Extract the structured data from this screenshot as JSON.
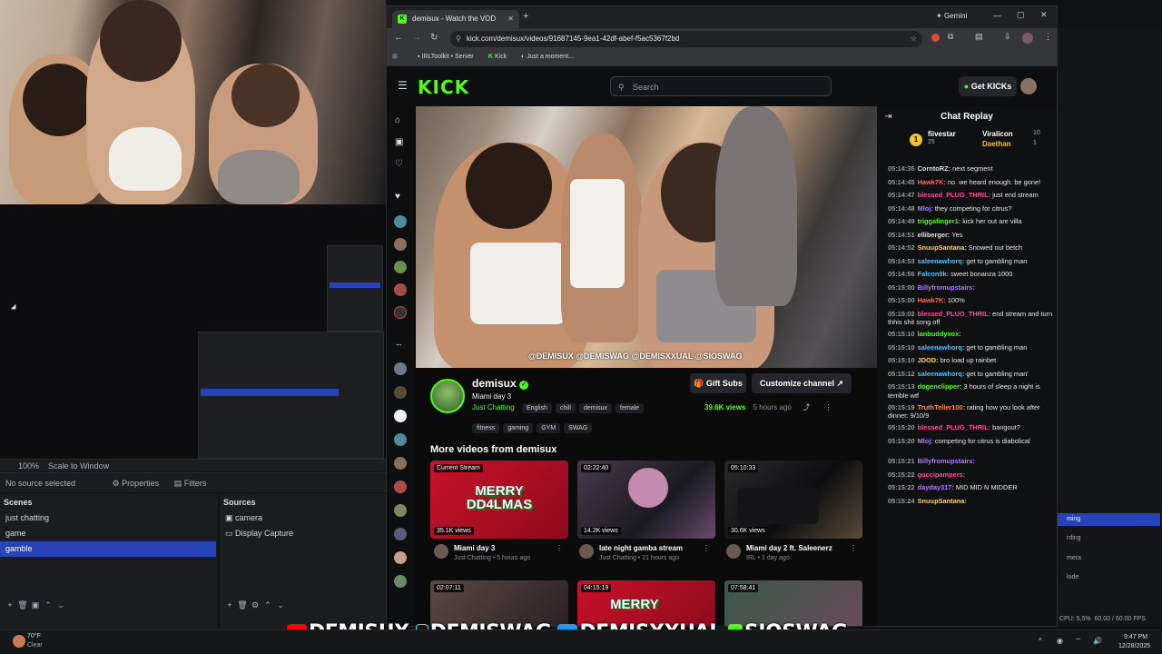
{
  "obs": {
    "no_source_label": "No source selected",
    "properties_label": "Properties",
    "filters_label": "Filters",
    "scenes_title": "Scenes",
    "sources_title": "Sources",
    "scenes": [
      "just chatting",
      "game",
      "gamble"
    ],
    "selected_scene": "gamble",
    "sources": [
      "camera",
      "Display Capture"
    ],
    "zoom_label": "100%",
    "scale_label": "Scale to Window",
    "right_items": [
      "ming",
      "rding",
      "mera",
      "lode"
    ],
    "status": "CPU: 5.5%",
    "fps": "60.00 / 60.00 FPS"
  },
  "browser": {
    "tab_title": "demisux - Watch the VOD",
    "new_tab": "+",
    "gemini_label": "Gemini",
    "url": "kick.com/demisux/videos/91687145-9ea1-42df-abef-f5ac5367f2bd",
    "bookmarks": [
      "IRLToolkit • Server",
      "Kick",
      "Just a moment..."
    ]
  },
  "kick": {
    "logo": "KICK",
    "search_placeholder": "Search",
    "get_kicks": "Get KICKs",
    "video_caption": "@DEMISUX @DEMISWAG @DEMISXXUAL @SIOSWAG",
    "channel_name": "demisux",
    "stream_title": "Miami day 3",
    "category": "Just Chatting",
    "tags_row1": [
      "English",
      "chill",
      "demisux",
      "female"
    ],
    "tags_row2": [
      "fitness",
      "gaming",
      "GYM",
      "SWAG"
    ],
    "gift_subs": "Gift Subs",
    "customize": "Customize channel",
    "views": "39.6K views",
    "ago": "5 hours ago",
    "more_videos": "More videos from demisux",
    "videos": [
      {
        "badge": "Current Stream",
        "views": "35.1K views",
        "title": "Miami day 3",
        "sub": "Just Chatting • 5 hours ago",
        "thumb_text": "MERRY DD4LMAS"
      },
      {
        "badge": "02:22:40",
        "views": "14.2K views",
        "title": "late night gamba stream",
        "sub": "Just Chatting • 21 hours ago",
        "thumb_text": ""
      },
      {
        "badge": "05:10:33",
        "views": "30.6K views",
        "title": "Miami day 2 ft. Saleenerz",
        "sub": "IRL • 1 day ago",
        "thumb_text": ""
      }
    ],
    "videos_row2": [
      {
        "badge": "02:07:11"
      },
      {
        "badge": "04:15:19",
        "thumb_text": "MERRY"
      },
      {
        "badge": "07:58:41"
      }
    ]
  },
  "chat": {
    "title": "Chat Replay",
    "leaders": [
      {
        "rank": "1",
        "name": "fiivestar",
        "count": "25"
      },
      {
        "rank": "",
        "name": "Viralicon",
        "count": "10"
      },
      {
        "rank": "",
        "name": "Daethan",
        "count": "1"
      }
    ],
    "messages": [
      {
        "t": "05:14:35",
        "u": "CorntoRZ:",
        "c": "#e0e0e0",
        "m": "next segment"
      },
      {
        "t": "05:14:45",
        "u": "Hawk7K:",
        "c": "#ff6b6b",
        "m": "no. we heard enough. be gone!"
      },
      {
        "t": "05:14:47",
        "u": "blessed_PLUG_THRIL:",
        "c": "#ff4fa0",
        "m": "just end stream"
      },
      {
        "t": "05:14:48",
        "u": "Mloj:",
        "c": "#b07bff",
        "m": "they competing for citrus?"
      },
      {
        "t": "05:14:49",
        "u": "triggafinger1:",
        "c": "#53fc18",
        "m": "kick her out are villa"
      },
      {
        "t": "05:14:51",
        "u": "elliberger:",
        "c": "#e0e0e0",
        "m": "Yes"
      },
      {
        "t": "05:14:52",
        "u": "SnuupSantana:",
        "c": "#ffd166",
        "m": "Snowed out betch"
      },
      {
        "t": "05:14:53",
        "u": "saleenawhorq:",
        "c": "#4fc3ff",
        "m": "get to gambling man"
      },
      {
        "t": "05:14:56",
        "u": "Falcon9k:",
        "c": "#4fc3ff",
        "m": "sweet bonanza 1000"
      },
      {
        "t": "05:15:00",
        "u": "Billyfromupstairs:",
        "c": "#b07bff",
        "m": ""
      },
      {
        "t": "05:15:00",
        "u": "Hawk7K:",
        "c": "#ff6b6b",
        "m": "100%"
      },
      {
        "t": "05:15:02",
        "u": "blessed_PLUG_THRIL:",
        "c": "#ff4fa0",
        "m": "end stream and turn thhis shit song off"
      },
      {
        "t": "05:15:10",
        "u": "lanbuddyxox:",
        "c": "#53fc18",
        "m": ""
      },
      {
        "t": "05:15:10",
        "u": "saleenawhorq:",
        "c": "#4fc3ff",
        "m": "get to gambling man"
      },
      {
        "t": "05:15:10",
        "u": "JDOD:",
        "c": "#ffd166",
        "m": "bro load up rainbet"
      },
      {
        "t": "05:15:12",
        "u": "saleenawhorq:",
        "c": "#4fc3ff",
        "m": "get to gambling man'"
      },
      {
        "t": "05:15:13",
        "u": "dogenclipper:",
        "c": "#53fc18",
        "m": "3 hours of sleep a night is terrible wtf"
      },
      {
        "t": "05:15:19",
        "u": "TruthTeller100:",
        "c": "#ff8c42",
        "m": "rating how you look after dinner: 9/10/9"
      },
      {
        "t": "05:15:20",
        "u": "blessed_PLUG_THRIL:",
        "c": "#ff4fa0",
        "m": "bangout?"
      },
      {
        "t": "05:15:20",
        "u": "Mloj:",
        "c": "#b07bff",
        "m": "competing for citrus is diabolical"
      },
      {
        "t": "05:15:21",
        "u": "Billyfromupstairs:",
        "c": "#b07bff",
        "m": ""
      },
      {
        "t": "05:15:22",
        "u": "guccipampers:",
        "c": "#ff4fa0",
        "m": ""
      },
      {
        "t": "05:15:22",
        "u": "dayday317:",
        "c": "#b07bff",
        "m": "MID MID N MIDDER"
      },
      {
        "t": "05:15:24",
        "u": "SnuupSantana:",
        "c": "#ffd166",
        "m": ""
      }
    ]
  },
  "overlay": {
    "handles": [
      "DEMISUX",
      "DEMISWAG",
      "DEMISXXUAL",
      "SIOSWAG"
    ]
  },
  "taskbar": {
    "weather": "70°F",
    "weather_sub": "Clear",
    "time": "9:47 PM",
    "date": "12/28/2025"
  },
  "colors": {
    "kick_green": "#53fc18",
    "obs_select": "#2643b8"
  }
}
